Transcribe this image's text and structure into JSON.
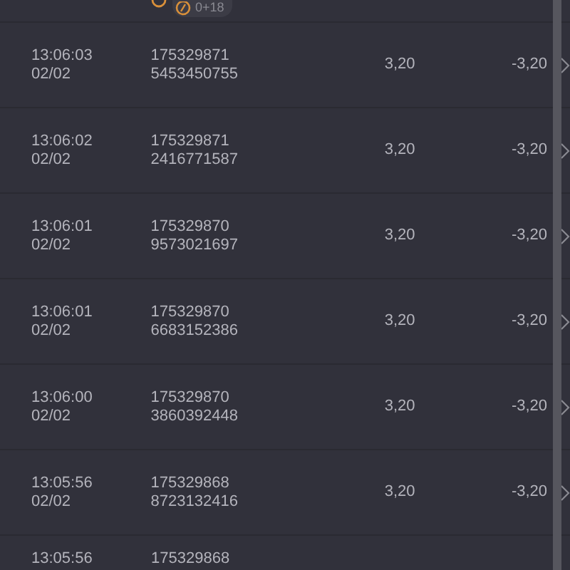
{
  "header_badge": {
    "text": "0+18"
  },
  "rows": [
    {
      "time": "13:06:03",
      "date": "02/02",
      "id_line_1": "175329871",
      "id_line_2": "5453450755",
      "amount": "3,20",
      "result": "-3,20"
    },
    {
      "time": "13:06:02",
      "date": "02/02",
      "id_line_1": "175329871",
      "id_line_2": "2416771587",
      "amount": "3,20",
      "result": "-3,20"
    },
    {
      "time": "13:06:01",
      "date": "02/02",
      "id_line_1": "175329870",
      "id_line_2": "9573021697",
      "amount": "3,20",
      "result": "-3,20"
    },
    {
      "time": "13:06:01",
      "date": "02/02",
      "id_line_1": "175329870",
      "id_line_2": "6683152386",
      "amount": "3,20",
      "result": "-3,20"
    },
    {
      "time": "13:06:00",
      "date": "02/02",
      "id_line_1": "175329870",
      "id_line_2": "3860392448",
      "amount": "3,20",
      "result": "-3,20"
    },
    {
      "time": "13:05:56",
      "date": "02/02",
      "id_line_1": "175329868",
      "id_line_2": "8723132416",
      "amount": "3,20",
      "result": "-3,20"
    }
  ],
  "partial_row": {
    "time": "13:05:56",
    "id_line_1": "175329868"
  }
}
